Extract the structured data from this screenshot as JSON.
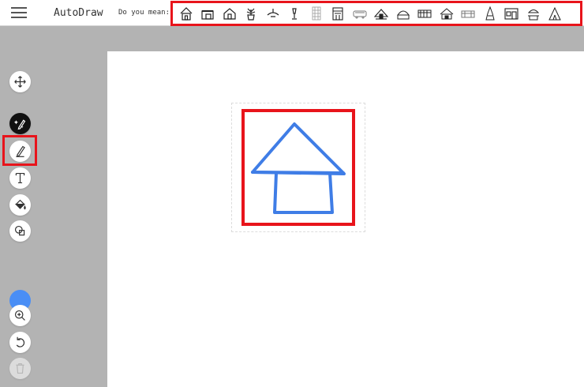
{
  "app": {
    "title": "AutoDraw"
  },
  "header": {
    "menu_icon": "hamburger-menu-icon",
    "suggestions_label": "Do you mean:",
    "suggestions": [
      "house-icon",
      "garage-icon",
      "house-outline-icon",
      "plant-pot-icon",
      "bird-icon",
      "trophy-icon",
      "building-grid-icon",
      "storefront-icon",
      "bus-icon",
      "hut-icon",
      "dome-building-icon",
      "fence-building-icon",
      "cottage-icon",
      "shed-icon",
      "tower-icon",
      "shop-window-icon",
      "pagoda-icon",
      "tent-icon"
    ]
  },
  "tools": [
    {
      "name": "move-tool",
      "icon": "move-arrows-icon"
    },
    {
      "name": "autodraw-tool",
      "icon": "autodraw-magic-pencil-icon",
      "active": true
    },
    {
      "name": "draw-tool",
      "icon": "pencil-icon"
    },
    {
      "name": "type-tool",
      "icon": "text-t-icon"
    },
    {
      "name": "fill-tool",
      "icon": "paint-bucket-icon"
    },
    {
      "name": "shape-tool",
      "icon": "shapes-icon"
    },
    {
      "name": "zoom-tool",
      "icon": "zoom-in-icon"
    },
    {
      "name": "undo-tool",
      "icon": "undo-icon"
    },
    {
      "name": "delete-tool",
      "icon": "trash-icon",
      "disabled": true
    }
  ],
  "colors": {
    "accent": "#e8141b",
    "stroke": "#3f7de6",
    "selected_swatch": "#4a8ef5"
  },
  "drawing": {
    "subject": "house-sketch"
  }
}
